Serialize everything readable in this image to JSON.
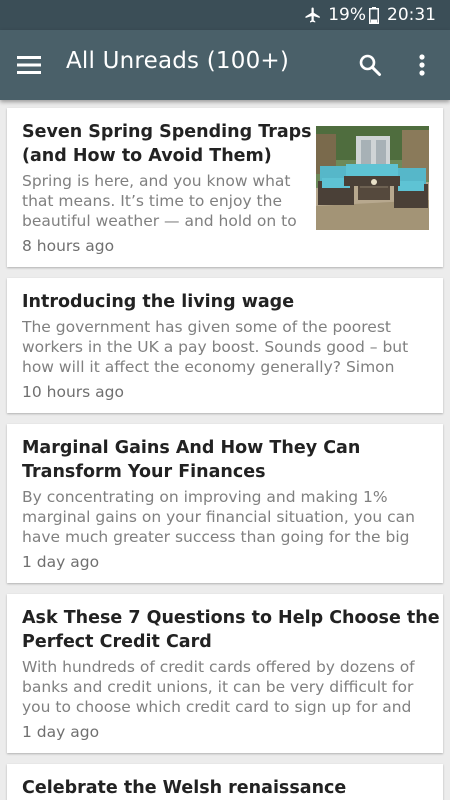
{
  "status_bar": {
    "battery_percent": "19%",
    "time": "20:31",
    "icons": [
      "airplane-mode-icon",
      "battery-icon"
    ]
  },
  "app_bar": {
    "title": "All Unreads (100+)",
    "icons": [
      "hamburger-menu-icon",
      "search-icon",
      "more-vertical-icon"
    ]
  },
  "articles": [
    {
      "title_lines": [
        "Seven Spring Spending Traps",
        "(and How to Avoid Them)"
      ],
      "snippet_lines": [
        "Spring is here, and you know what",
        "that means. It’s time to enjoy the",
        "beautiful weather —  and hold on to"
      ],
      "time": "8 hours ago",
      "thumbnail": "patio-furniture-image"
    },
    {
      "title_lines": [
        "Introducing the living wage"
      ],
      "snippet_lines": [
        "The government has given some of the poorest",
        "workers in the UK a pay boost. Sounds good – but",
        "how will it affect the economy generally? Simon"
      ],
      "time": "10 hours ago"
    },
    {
      "title_lines": [
        "Marginal Gains And How They Can",
        "Transform Your Finances"
      ],
      "snippet_lines": [
        "By concentrating on improving and making 1%",
        "marginal gains on your financial situation, you can",
        "have much greater success than going for the big"
      ],
      "time": "1 day ago"
    },
    {
      "title_lines": [
        "Ask These 7 Questions to Help Choose the",
        "Perfect Credit Card"
      ],
      "snippet_lines": [
        "With hundreds of credit cards offered by dozens of",
        "banks and credit unions, it can be very difficult for",
        "you to choose which credit card to sign up for and"
      ],
      "time": "1 day ago"
    },
    {
      "title_lines": [
        "Celebrate the Welsh renaissance"
      ]
    }
  ]
}
